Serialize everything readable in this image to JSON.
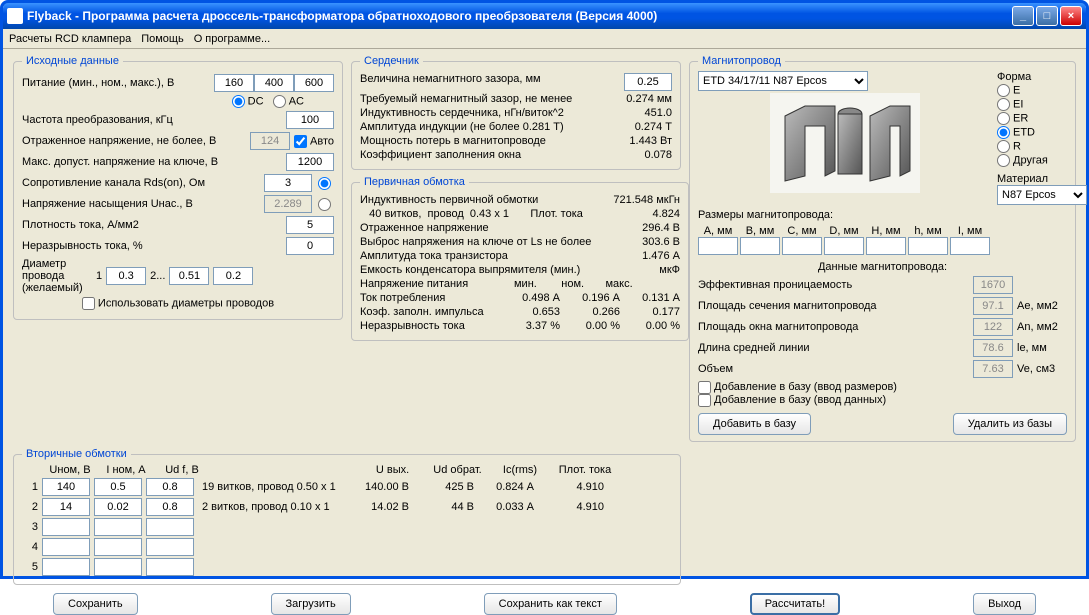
{
  "window": {
    "title": "Flyback - Программа расчета дроссель-трансформатора обратноходового преобрзователя (Версия 4000)"
  },
  "menu": {
    "rcd": "Расчеты RCD клампера",
    "help": "Помощь",
    "about": "О программе..."
  },
  "source": {
    "legend": "Исходные данные",
    "supply_label": "Питание (мин., ном., макс.), В",
    "supply_min": "160",
    "supply_nom": "400",
    "supply_max": "600",
    "dc": "DC",
    "ac": "AC",
    "freq_label": "Частота преобразования, кГц",
    "freq": "100",
    "refl_label": "Отраженное напряжение, не более, В",
    "refl": "124",
    "auto": "Авто",
    "vmax_label": "Макс. допуст. напряжение на ключе, В",
    "vmax": "1200",
    "rds_label": "Сопротивление канала Rds(on), Ом",
    "rds": "3",
    "usat_label": "Напряжение насыщения Uнас., В",
    "usat": "2.289",
    "jdens_label": "Плотность тока, А/мм2",
    "jdens": "5",
    "cont_label": "Неразрывность тока, %",
    "cont": "0",
    "diam_label1": "Диаметр",
    "diam_label2": "провода",
    "diam_label3": "(желаемый)",
    "d1": "1",
    "d1v": "0.3",
    "d2": "2...",
    "d2v": "0.51",
    "d3v": "0.2",
    "usediam": "Использовать диаметры проводов"
  },
  "core": {
    "legend": "Сердечник",
    "g1": "Величина немагнитного зазора, мм",
    "g1v": "0.25",
    "g2": "Требуемый немагнитный зазор, не менее",
    "g2v": "0.274 мм",
    "g3": "Индуктивность сердечника, нГн/виток^2",
    "g3v": "451.0",
    "g4": "Амплитуда индукции      (не более 0.281 Т)",
    "g4v": "0.274 Т",
    "g5": "Мощность потерь в магнитопроводе",
    "g5v": "1.443 Вт",
    "g6": "Коэффициент заполнения окна",
    "g6v": "0.078"
  },
  "primary": {
    "legend": "Первичная обмотка",
    "p1": "Индуктивность первичной обмотки",
    "p1v": "721.548 мкГн",
    "p2": "   40 витков,  провод  0.43 x 1       Плот. тока",
    "p2v": "4.824",
    "p3": "Отраженное напряжение",
    "p3v": "296.4 В",
    "p4": "Выброс напряжения на ключе от Ls не более",
    "p4v": "303.6 В",
    "p5": "Амплитуда тока транзистора",
    "p5v": "1.476 А",
    "p6": "Емкость конденсатора выпрямителя (мин.)",
    "p6v": "мкФ",
    "p7": "Напряжение питания               мин.        ном.       макс.",
    "p8": "Ток потребления",
    "p8a": "0.498 А",
    "p8b": "0.196 А",
    "p8c": "0.131 А",
    "p9": "Коэф. заполн. импульса",
    "p9a": "0.653",
    "p9b": "0.266",
    "p9c": "0.177",
    "p10": "Неразрывность  тока",
    "p10a": "3.37 %",
    "p10b": "0.00 %",
    "p10c": "0.00 %"
  },
  "secondary": {
    "legend": "Вторичные обмотки",
    "h_unom": "Uном, В",
    "h_inom": "I ном, А",
    "h_udf": "Ud f, B",
    "h_uvyh": "U вых.",
    "h_udobr": "Ud обрат.",
    "h_ic": "Ic(rms)",
    "h_plot": "Плот. тока",
    "rows": [
      {
        "n": "1",
        "unom": "140",
        "inom": "0.5",
        "udf": "0.8",
        "desc": "19 витков, провод 0.50 x 1",
        "uvyh": "140.00 В",
        "udobr": "425 В",
        "ic": "0.824 А",
        "plot": "4.910"
      },
      {
        "n": "2",
        "unom": "14",
        "inom": "0.02",
        "udf": "0.8",
        "desc": "2 витков, провод 0.10 x 1",
        "uvyh": "14.02 В",
        "udobr": "44 В",
        "ic": "0.033 А",
        "plot": "4.910"
      },
      {
        "n": "3",
        "unom": "",
        "inom": "",
        "udf": "",
        "desc": "",
        "uvyh": "",
        "udobr": "",
        "ic": "",
        "plot": ""
      },
      {
        "n": "4",
        "unom": "",
        "inom": "",
        "udf": "",
        "desc": "",
        "uvyh": "",
        "udobr": "",
        "ic": "",
        "plot": ""
      },
      {
        "n": "5",
        "unom": "",
        "inom": "",
        "udf": "",
        "desc": "",
        "uvyh": "",
        "udobr": "",
        "ic": "",
        "plot": ""
      }
    ]
  },
  "mag": {
    "legend": "Магнитопровод",
    "select": "ETD 34/17/11 N87 Epcos",
    "shape": "Форма",
    "shapes": {
      "e": "E",
      "ei": "EI",
      "er": "ER",
      "etd": "ETD",
      "r": "R",
      "other": "Другая"
    },
    "material": "Материал",
    "material_sel": "N87 Epcos",
    "dims_label": "Размеры магнитопровода:",
    "dims": [
      "A, мм",
      "B, мм",
      "C, мм",
      "D, мм",
      "H, мм",
      "h, мм",
      "I, мм"
    ],
    "data_label": "Данные магнитопровода:",
    "d1": "Эффективная проницаемость",
    "d1v": "1670",
    "d1u": "",
    "d2": "Площадь сечения магнитопровода",
    "d2v": "97.1",
    "d2u": "Ae, мм2",
    "d3": "Площадь окна магнитопровода",
    "d3v": "122",
    "d3u": "An, мм2",
    "d4": "Длина средней линии",
    "d4v": "78.6",
    "d4u": "le, мм",
    "d5": "Объем",
    "d5v": "7.63",
    "d5u": "Ve, см3",
    "cb1": "Добавление в базу (ввод размеров)",
    "cb2": "Добавление в базу (ввод данных)",
    "add": "Добавить в базу",
    "del": "Удалить из базы"
  },
  "buttons": {
    "save": "Сохранить",
    "load": "Загрузить",
    "savetxt": "Сохранить как текст",
    "calc": "Рассчитать!",
    "exit": "Выход"
  }
}
